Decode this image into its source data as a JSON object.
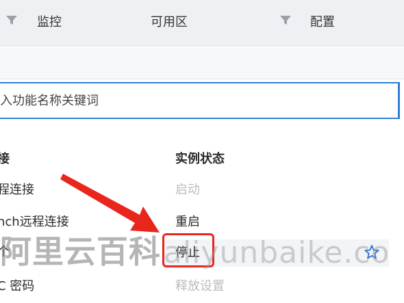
{
  "table_header": {
    "columns": [
      {
        "label": "监控",
        "has_filter": true
      },
      {
        "label": "可用区",
        "has_filter": false
      },
      {
        "label": "配置",
        "has_filter": true
      }
    ]
  },
  "search": {
    "placeholder": "入功能名称关键词"
  },
  "menu": {
    "left_column_title": "接",
    "right_column_title": "实例状态",
    "left_items": [
      "程连接",
      "nch远程连接",
      "个",
      "C 密码"
    ],
    "right_items": [
      {
        "label": "启动",
        "disabled": true
      },
      {
        "label": "重启",
        "disabled": false
      },
      {
        "label": "停止",
        "disabled": false,
        "highlighted": true
      },
      {
        "label": "释放设置",
        "disabled": true
      }
    ]
  },
  "watermark": {
    "cn": "阿里云百科",
    "en": "aliyunbaike.co"
  },
  "colors": {
    "accent_blue": "#2f7fd6",
    "highlight_red": "#e8261c",
    "arrow_red": "#e8261c",
    "star_blue": "#2a6fd0"
  }
}
